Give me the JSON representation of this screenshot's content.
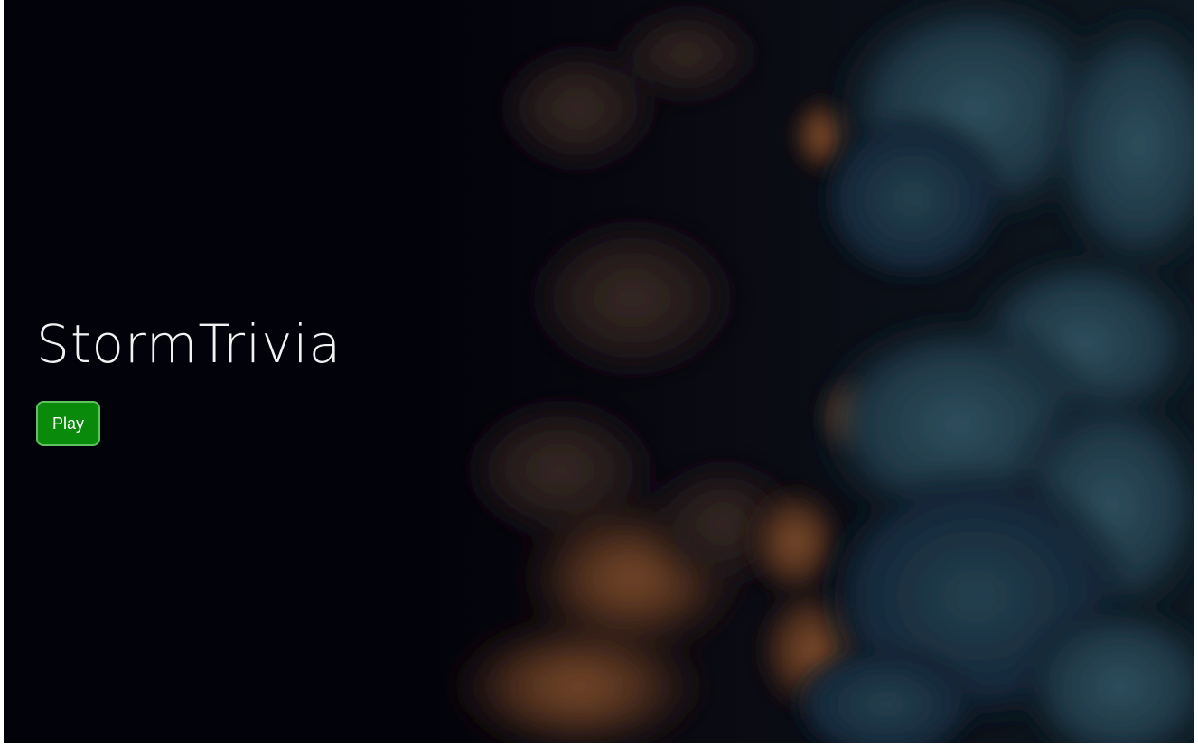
{
  "hero": {
    "title": "StormTrivia",
    "play_label": "Play"
  },
  "colors": {
    "background": "#02020a",
    "button": "#0a8a0a",
    "button_border": "#5ec15e",
    "title": "#f2f2f2"
  }
}
